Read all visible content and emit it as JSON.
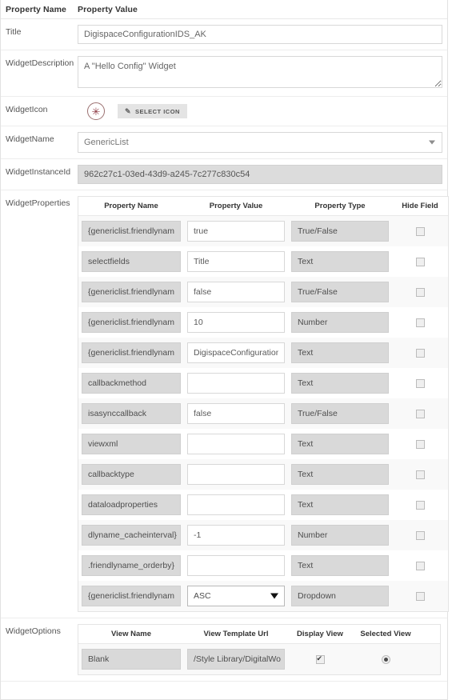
{
  "header": {
    "property_name": "Property Name",
    "property_value": "Property Value"
  },
  "fields": {
    "title": {
      "label": "Title",
      "value": "DigispaceConfigurationIDS_AK"
    },
    "description": {
      "label": "WidgetDescription",
      "value": "A \"Hello Config\" Widget"
    },
    "icon": {
      "label": "WidgetIcon",
      "glyph": "✳",
      "button_label": "Select Icon",
      "pencil": "✎"
    },
    "name": {
      "label": "WidgetName",
      "value": "GenericList"
    },
    "instance": {
      "label": "WidgetInstanceId",
      "value": "962c27c1-03ed-43d9-a245-7c277c830c54"
    },
    "properties": {
      "label": "WidgetProperties"
    },
    "options": {
      "label": "WidgetOptions"
    }
  },
  "properties_table": {
    "columns": [
      "Property Name",
      "Property Value",
      "Property Type",
      "Hide Field"
    ],
    "rows": [
      {
        "name": "{genericlist.friendlynam",
        "value": "true",
        "type": "True/False",
        "control": "input",
        "hide": false
      },
      {
        "name": "selectfields",
        "value": "Title",
        "type": "Text",
        "control": "input",
        "hide": false
      },
      {
        "name": "{genericlist.friendlynam",
        "value": "false",
        "type": "True/False",
        "control": "input",
        "hide": false
      },
      {
        "name": "{genericlist.friendlynam",
        "value": "10",
        "type": "Number",
        "control": "input",
        "hide": false
      },
      {
        "name": "{genericlist.friendlynam",
        "value": "DigispaceConfigurationI",
        "type": "Text",
        "control": "input",
        "hide": false
      },
      {
        "name": "callbackmethod",
        "value": "",
        "type": "Text",
        "control": "input",
        "hide": false
      },
      {
        "name": "isasynccallback",
        "value": "false",
        "type": "True/False",
        "control": "input",
        "hide": false
      },
      {
        "name": "viewxml",
        "value": "",
        "type": "Text",
        "control": "input",
        "hide": false
      },
      {
        "name": "callbacktype",
        "value": "",
        "type": "Text",
        "control": "input",
        "hide": false
      },
      {
        "name": "dataloadproperties",
        "value": "",
        "type": "Text",
        "control": "input",
        "hide": false
      },
      {
        "name": "dlyname_cacheinterval}",
        "value": "-1",
        "type": "Number",
        "control": "input",
        "hide": false
      },
      {
        "name": ".friendlyname_orderby}",
        "value": "",
        "type": "Text",
        "control": "input",
        "hide": false
      },
      {
        "name": "{genericlist.friendlynam",
        "value": "ASC",
        "type": "Dropdown",
        "control": "select",
        "hide": false
      }
    ]
  },
  "options_table": {
    "columns": [
      "View Name",
      "View Template Url",
      "Display View",
      "Selected View"
    ],
    "rows": [
      {
        "view_name": "Blank",
        "template_url": "/Style Library/DigitalWo",
        "display_view": true,
        "selected_view": true
      }
    ]
  },
  "colors": {
    "icon_accent": "#8f3b46",
    "readonly_bg": "#d9d9d9",
    "alt_row_bg": "#f9f9f9",
    "border": "#e4e4e4"
  }
}
